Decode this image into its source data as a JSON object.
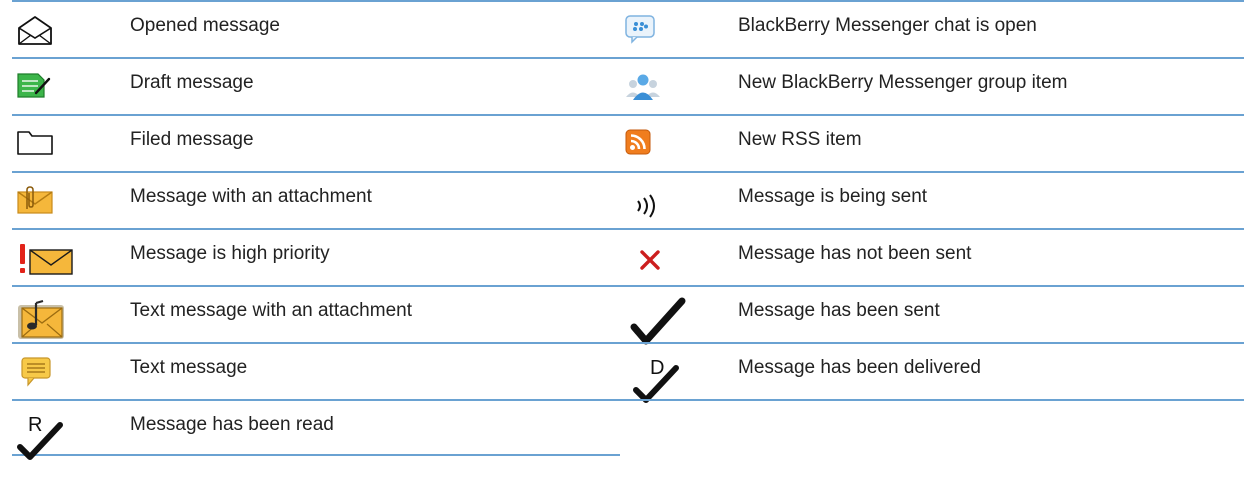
{
  "rows": [
    {
      "left": {
        "icon": "opened-message-icon",
        "label": "Opened message"
      },
      "right": {
        "icon": "bbm-chat-open-icon",
        "label": "BlackBerry Messenger chat is open"
      }
    },
    {
      "left": {
        "icon": "draft-message-icon",
        "label": "Draft message"
      },
      "right": {
        "icon": "bbm-group-item-icon",
        "label": "New BlackBerry Messenger group item"
      }
    },
    {
      "left": {
        "icon": "filed-message-icon",
        "label": "Filed message"
      },
      "right": {
        "icon": "rss-icon",
        "label": "New RSS item"
      }
    },
    {
      "left": {
        "icon": "attachment-message-icon",
        "label": "Message with an attachment"
      },
      "right": {
        "icon": "sending-icon",
        "label": "Message is being sent"
      }
    },
    {
      "left": {
        "icon": "high-priority-message-icon",
        "label": "Message is high priority"
      },
      "right": {
        "icon": "not-sent-icon",
        "label": "Message has not been sent"
      }
    },
    {
      "left": {
        "icon": "text-message-attachment-icon",
        "label": "Text message with an attachment"
      },
      "right": {
        "icon": "sent-check-icon",
        "label": "Message has been sent"
      }
    },
    {
      "left": {
        "icon": "text-message-icon",
        "label": "Text message"
      },
      "right": {
        "icon": "delivered-check-icon",
        "label": "Message has been delivered",
        "glyph": "D"
      }
    },
    {
      "left": {
        "icon": "read-check-icon",
        "label": "Message has been read",
        "glyph": "R"
      },
      "right": null
    }
  ],
  "colors": {
    "rule": "#6aa2d2",
    "draft_green": "#3cb54a",
    "envelope_orange": "#f5b73b",
    "rss_orange": "#f07d1e",
    "bbm_blue": "#5aa9e6",
    "error_red": "#cc1e1e",
    "priority_red": "#e2231a"
  }
}
